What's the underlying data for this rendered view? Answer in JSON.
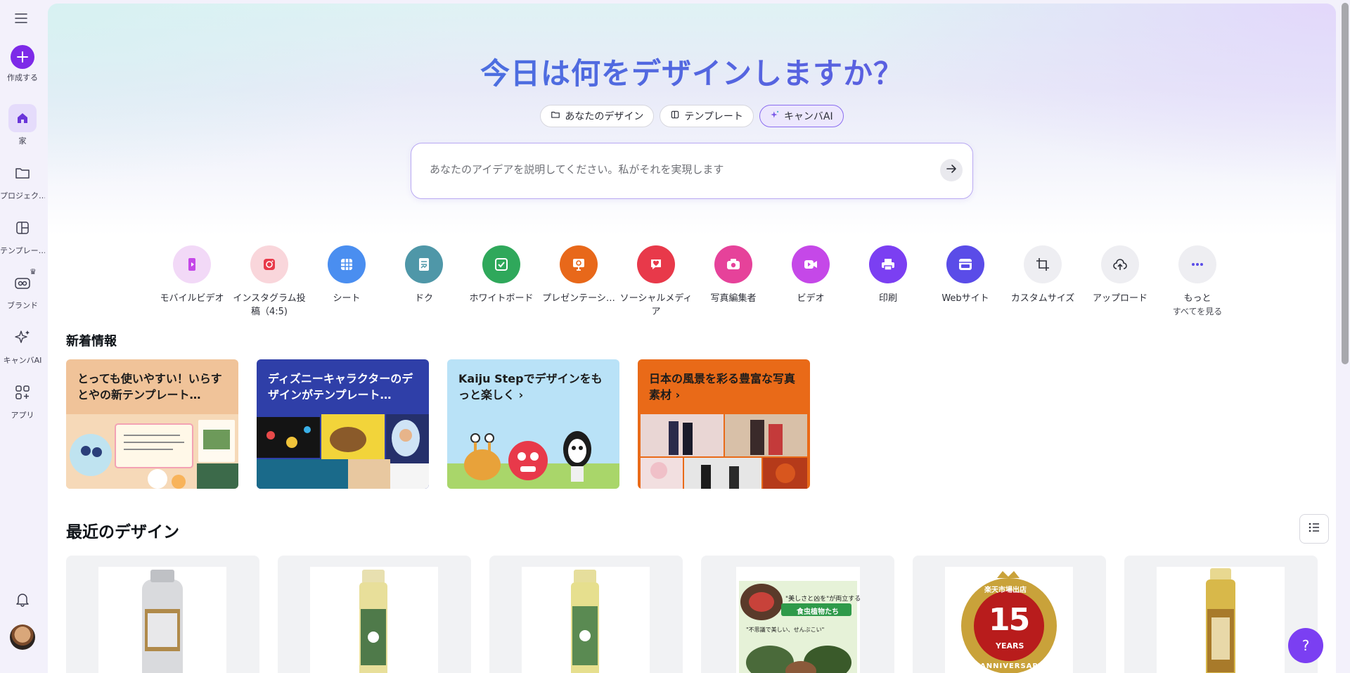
{
  "sidebar": {
    "create_label": "作成する",
    "items": [
      {
        "label": "家",
        "icon": "home-icon"
      },
      {
        "label": "プロジェク…",
        "icon": "folder-icon"
      },
      {
        "label": "テンプレー…",
        "icon": "template-icon"
      },
      {
        "label": "ブランド",
        "icon": "brand-icon"
      },
      {
        "label": "キャンバAI",
        "icon": "sparkle-icon"
      },
      {
        "label": "アプリ",
        "icon": "apps-icon"
      }
    ]
  },
  "hero": {
    "title": "今日は何をデザインしますか？",
    "chips": [
      {
        "label": "あなたのデザイン",
        "icon": "folder-icon"
      },
      {
        "label": "テンプレート",
        "icon": "template-icon"
      },
      {
        "label": "キャンバAI",
        "icon": "sparkle-icon"
      }
    ],
    "search_placeholder": "あなたのアイデアを説明してください。私がそれを実現します"
  },
  "categories": [
    {
      "label": "モバイルビデオ",
      "color": "#f2d9f7",
      "icon": "mobile-video-icon"
    },
    {
      "label": "インスタグラム投稿（4:5)",
      "color": "#f9d6db",
      "icon": "instagram-icon"
    },
    {
      "label": "シート",
      "color": "#4a8ef0",
      "icon": "sheet-icon"
    },
    {
      "label": "ドク",
      "color": "#4f97a8",
      "icon": "doc-icon"
    },
    {
      "label": "ホワイトボード",
      "color": "#2fa85b",
      "icon": "whiteboard-icon"
    },
    {
      "label": "プレゼンテーシ…",
      "color": "#e8681a",
      "icon": "presentation-icon"
    },
    {
      "label": "ソーシャルメディア",
      "color": "#e8394a",
      "icon": "social-media-icon"
    },
    {
      "label": "写真編集者",
      "color": "#e6429a",
      "icon": "camera-icon"
    },
    {
      "label": "ビデオ",
      "color": "#c548e8",
      "icon": "video-icon"
    },
    {
      "label": "印刷",
      "color": "#7b3ff2",
      "icon": "print-icon"
    },
    {
      "label": "Webサイト",
      "color": "#5a4ce8",
      "icon": "website-icon"
    },
    {
      "label": "カスタムサイズ",
      "color": "#eeeef2",
      "icon": "custom-size-icon"
    },
    {
      "label": "アップロード",
      "color": "#eeeef2",
      "icon": "upload-icon"
    },
    {
      "label": "もっと",
      "sub": "すべてを見る",
      "color": "#eeeef2",
      "icon": "more-icon"
    }
  ],
  "whats_new": {
    "title": "新着情報",
    "cards": [
      {
        "title": "とっても使いやすい！いらすとやの新テンプレート…",
        "bg": "#f0c399",
        "text_color": "#1c1c1c"
      },
      {
        "title": "ディズニーキャラクターのデザインがテンプレート…",
        "bg": "#2f3fa8",
        "text_color": "#ffffff"
      },
      {
        "title": "Kaiju Stepでデザインをもっと楽しく ›",
        "bg": "#b9e2f7",
        "text_color": "#1c1c1c"
      },
      {
        "title": "日本の風景を彩る豊富な写真素材 ›",
        "bg": "#e96a18",
        "text_color": "#1c1c1c"
      }
    ]
  },
  "recent": {
    "title": "最近のデザイン",
    "poster_lines": [
      "\"美しさと凶を\"が両立する",
      "食虫植物たち",
      "\"不思議で美しい、せんぶこい\""
    ],
    "badge": {
      "top": "楽天市場出店",
      "number": "15",
      "unit": "YEARS",
      "bottom": "ANNIVERSARY"
    }
  },
  "help_label": "?"
}
